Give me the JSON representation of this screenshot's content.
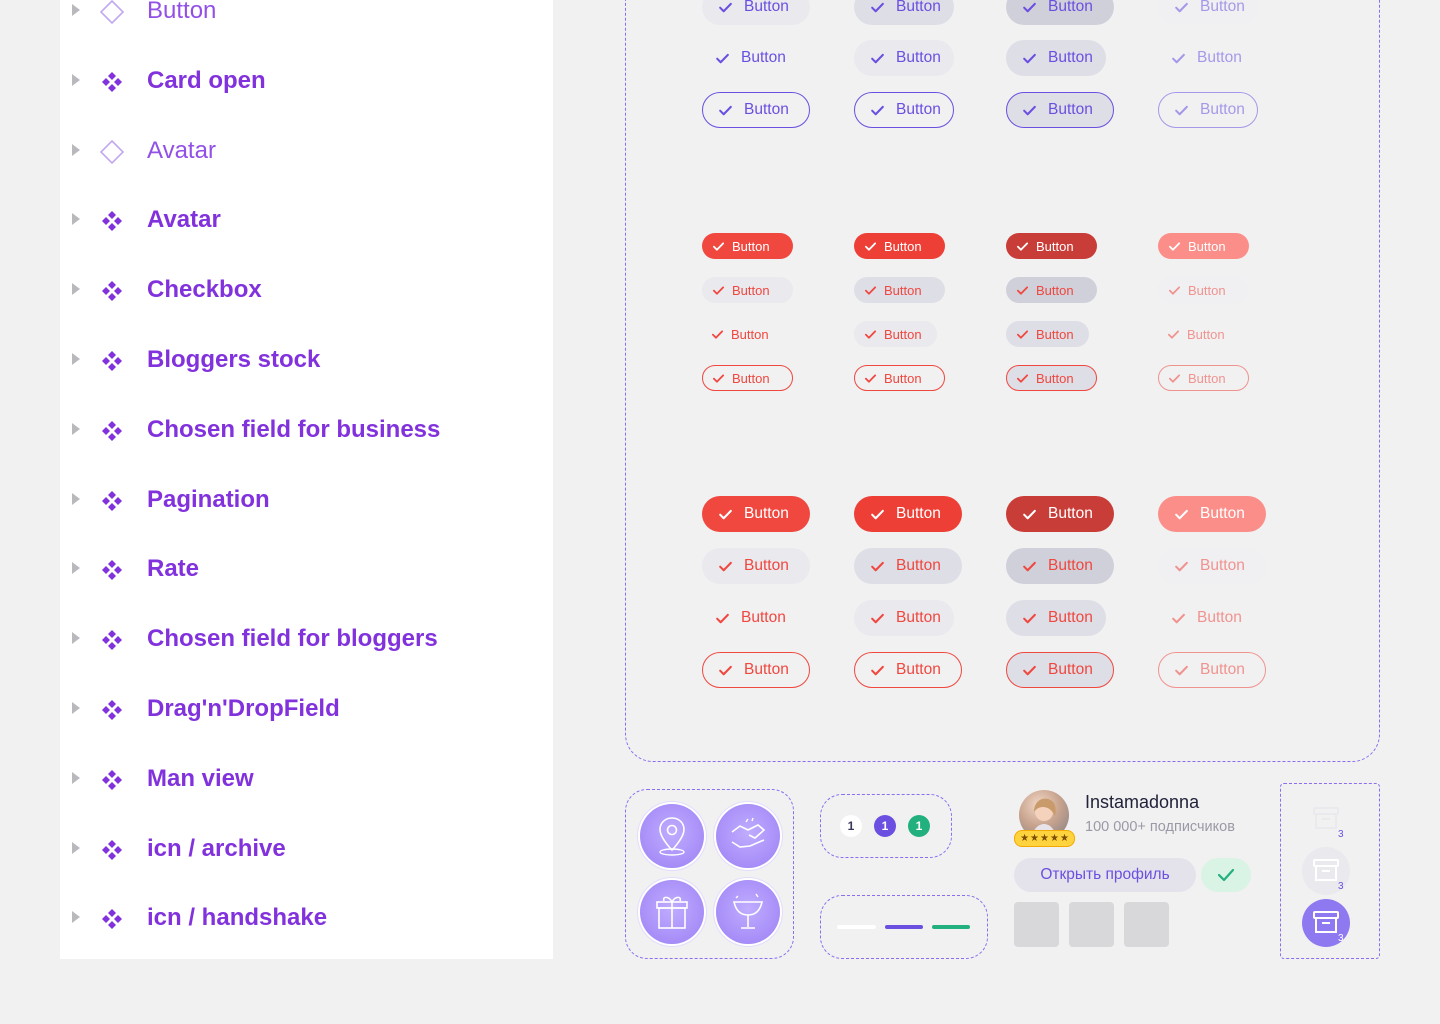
{
  "layers": [
    {
      "label": "Button",
      "kind": "instance"
    },
    {
      "label": "Card open",
      "kind": "component"
    },
    {
      "label": "Avatar",
      "kind": "instance"
    },
    {
      "label": "Avatar",
      "kind": "component"
    },
    {
      "label": "Checkbox",
      "kind": "component"
    },
    {
      "label": "Bloggers stock",
      "kind": "component"
    },
    {
      "label": "Chosen field for business",
      "kind": "component"
    },
    {
      "label": "Pagination",
      "kind": "component"
    },
    {
      "label": "Rate",
      "kind": "component"
    },
    {
      "label": "Chosen field for bloggers",
      "kind": "component"
    },
    {
      "label": "Drag'n'DropField",
      "kind": "component"
    },
    {
      "label": "Man view",
      "kind": "component"
    },
    {
      "label": "icn / archive",
      "kind": "component"
    },
    {
      "label": "icn / handshake",
      "kind": "component"
    }
  ],
  "button_label": "Button",
  "colors": {
    "violet": "#6b4fe0",
    "red": "#f0473f",
    "red_dark": "#c93d38",
    "red_light": "#fb8e88",
    "gray_light": "#e9e9ee",
    "gray": "#dedee6",
    "gray_dark": "#cfd0d9",
    "green": "#22b07f",
    "component_purple": "#8232dd"
  },
  "profile": {
    "name": "Instamadonna",
    "subscribers": "100 000+ подписчиков",
    "open_profile": "Открыть профиль",
    "stars": 5
  },
  "pagination": [
    "1",
    "1",
    "1"
  ],
  "archive_badges": [
    "3",
    "3",
    "3"
  ]
}
